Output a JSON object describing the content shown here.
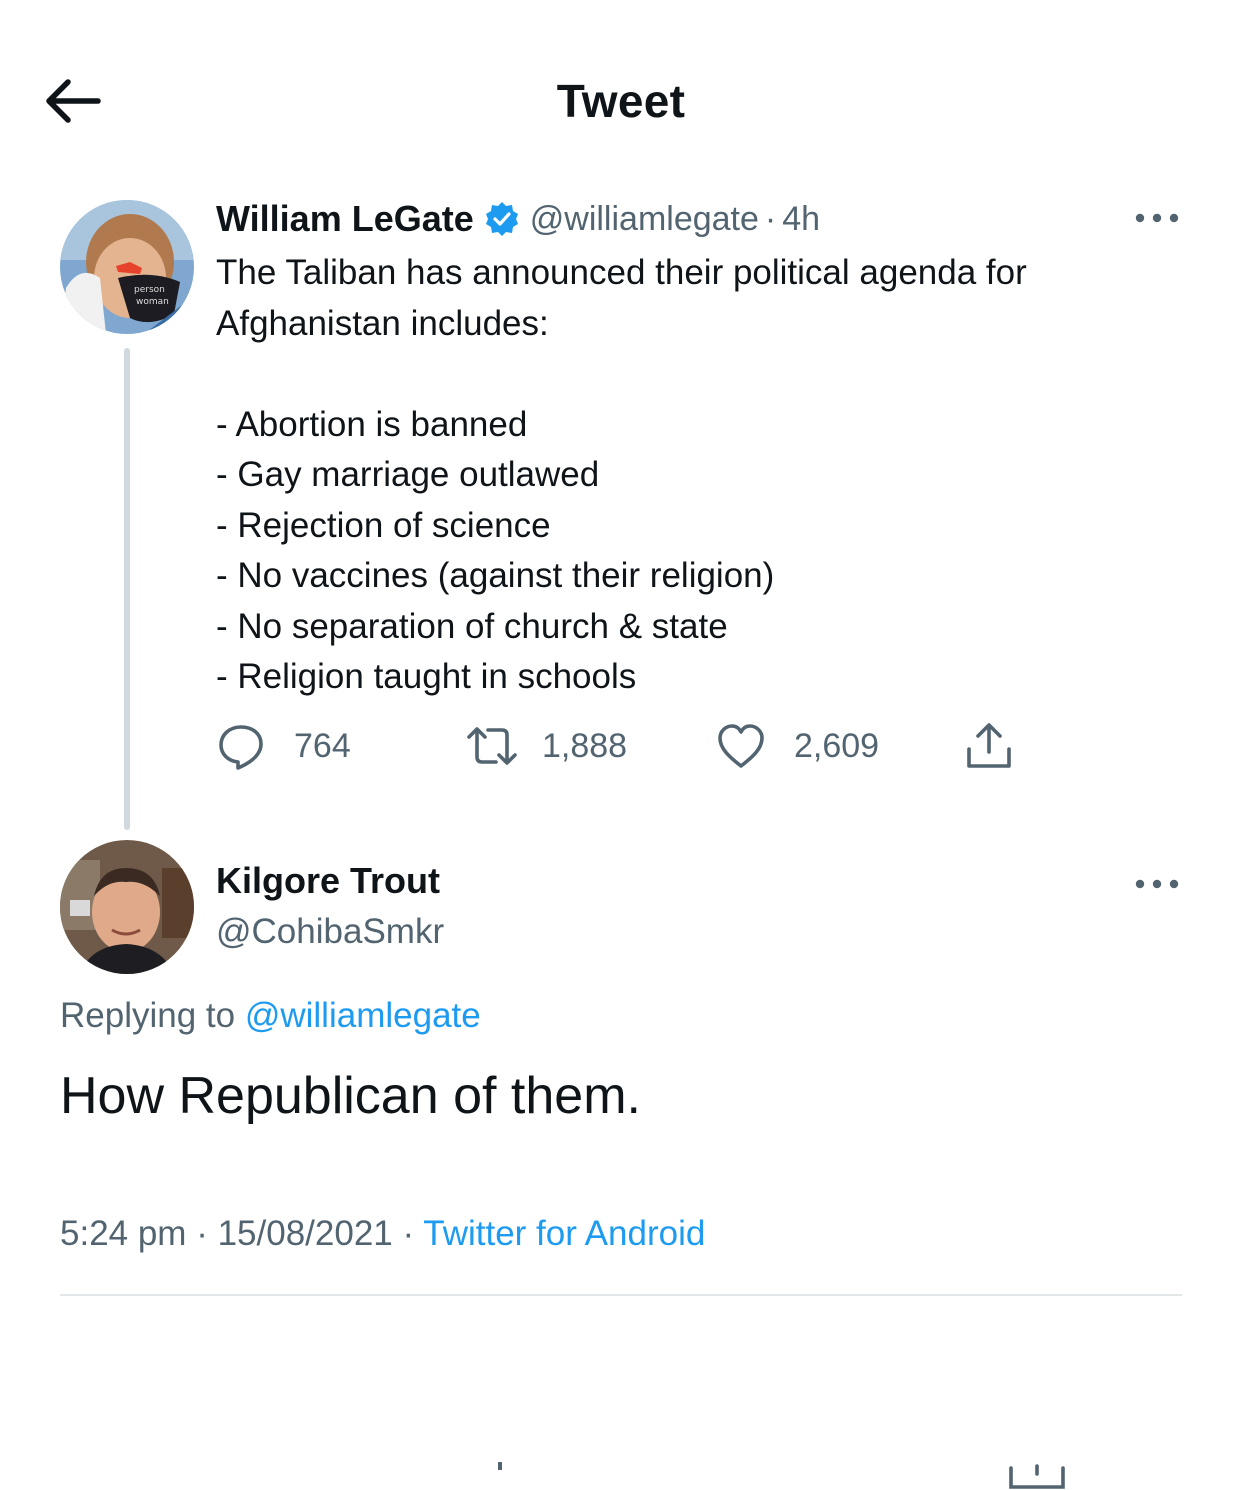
{
  "header": {
    "title": "Tweet",
    "back_icon": "arrow-left-icon"
  },
  "tweet": {
    "author_name": "William LeGate",
    "verified": true,
    "handle": "@williamlegate",
    "separator": "·",
    "time": "4h",
    "text_lines": [
      "The Taliban has announced their political agenda for",
      "Afghanistan includes:",
      "",
      "- Abortion is banned",
      "- Gay marriage outlawed",
      "- Rejection of science",
      "- No vaccines (against their religion)",
      "- No separation of church & state",
      "- Religion taught in schools"
    ],
    "actions": {
      "replies": "764",
      "retweets": "1,888",
      "likes": "2,609"
    }
  },
  "reply": {
    "author_name": "Kilgore Trout",
    "handle": "@CohibaSmkr",
    "replying_prefix": "Replying to ",
    "replying_to": "@williamlegate",
    "text": "How Republican of them.",
    "time": "5:24 pm",
    "separator": "·",
    "date": "15/08/2021",
    "source": "Twitter for Android"
  },
  "colors": {
    "text_primary": "#0f1419",
    "text_secondary": "#536471",
    "accent": "#1d9bf0",
    "thread_line": "#cfd9de"
  }
}
